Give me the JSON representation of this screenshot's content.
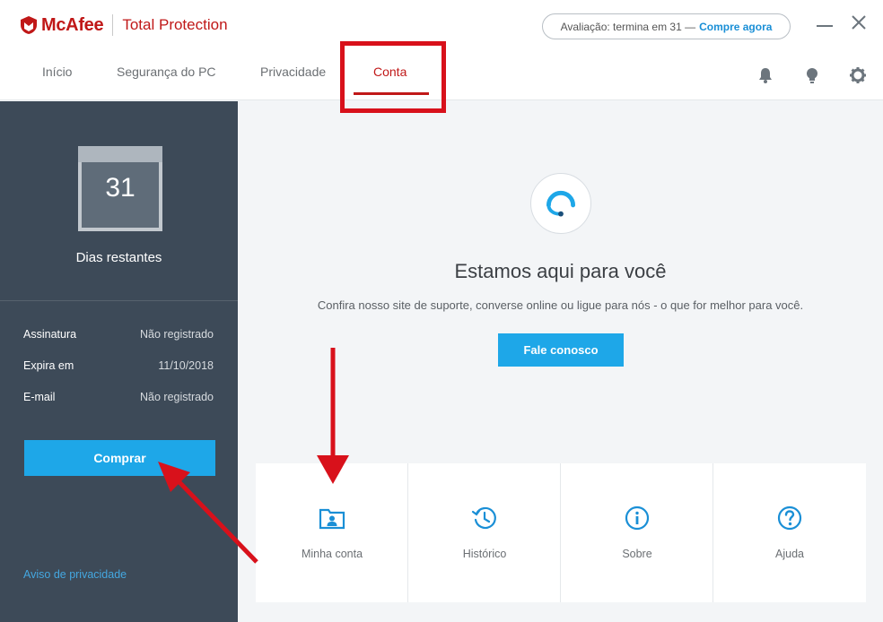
{
  "header": {
    "logo": "McAfee",
    "product": "Total Protection",
    "trial_text": "Avaliação: termina em 31 —",
    "trial_buy": "Compre agora"
  },
  "tabs": [
    {
      "label": "Início"
    },
    {
      "label": "Segurança do PC"
    },
    {
      "label": "Privacidade"
    },
    {
      "label": "Conta",
      "active": true
    }
  ],
  "sidebar": {
    "days_number": "31",
    "days_label": "Dias restantes",
    "rows": [
      {
        "label": "Assinatura",
        "value": "Não registrado"
      },
      {
        "label": "Expira em",
        "value": "11/10/2018"
      },
      {
        "label": "E-mail",
        "value": "Não registrado"
      }
    ],
    "buy_button": "Comprar",
    "privacy_link": "Aviso de privacidade"
  },
  "main": {
    "title": "Estamos aqui para você",
    "description": "Confira nosso site de suporte, converse online ou ligue para nós - o que for melhor para você.",
    "contact_button": "Fale conosco",
    "cards": [
      {
        "label": "Minha conta",
        "icon": "account-folder-icon"
      },
      {
        "label": "Histórico",
        "icon": "history-icon"
      },
      {
        "label": "Sobre",
        "icon": "info-icon"
      },
      {
        "label": "Ajuda",
        "icon": "help-icon"
      }
    ]
  },
  "colors": {
    "brand_red": "#c01818",
    "accent_blue": "#1ea7e8",
    "sidebar_bg": "#3d4a58",
    "annotation_red": "#d8111b"
  }
}
